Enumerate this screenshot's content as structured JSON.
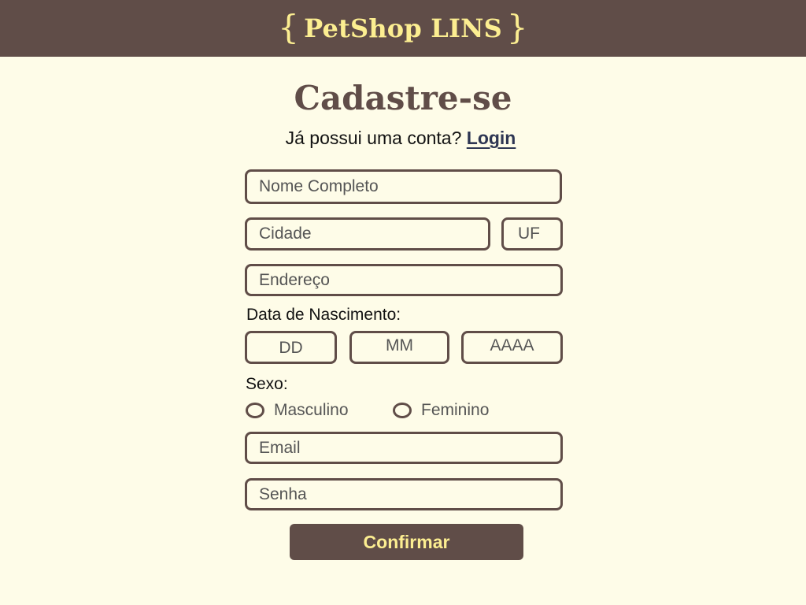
{
  "header": {
    "brace_open": "{",
    "brand": "PetShop LINS",
    "brace_close": "}"
  },
  "page": {
    "title": "Cadastre-se",
    "login_prompt": "Já possui uma conta?",
    "login_link": "Login"
  },
  "form": {
    "nome_placeholder": "Nome Completo",
    "cidade_placeholder": "Cidade",
    "uf_placeholder": "UF",
    "endereco_placeholder": "Endereço",
    "birth_label": "Data de Nascimento:",
    "dd_placeholder": "DD",
    "mm_placeholder": "MM",
    "aaaa_placeholder": "AAAA",
    "sexo_label": "Sexo:",
    "sexo_options": [
      "Masculino",
      "Feminino"
    ],
    "email_placeholder": "Email",
    "senha_placeholder": "Senha",
    "confirm_label": "Confirmar"
  },
  "colors": {
    "header_bg": "#604d48",
    "brand_text": "#fcee91",
    "page_bg": "#fefce8",
    "link": "#2e3653"
  }
}
